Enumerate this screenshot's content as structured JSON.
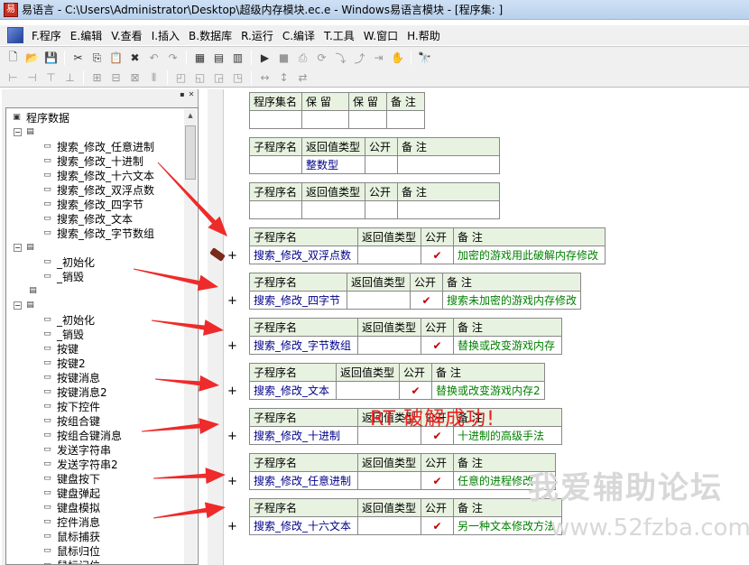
{
  "window": {
    "title": "易语言 - C:\\Users\\Administrator\\Desktop\\超级内存模块.ec.e - Windows易语言模块 - [程序集: ]"
  },
  "menu": [
    "F.程序",
    "E.编辑",
    "V.查看",
    "I.插入",
    "B.数据库",
    "R.运行",
    "C.编译",
    "T.工具",
    "W.窗口",
    "H.帮助"
  ],
  "tree": {
    "root": "程序数据",
    "group1_items": [
      "搜索_修改_任意进制",
      "搜索_修改_十进制",
      "搜索_修改_十六文本",
      "搜索_修改_双浮点数",
      "搜索_修改_四字节",
      "搜索_修改_文本",
      "搜索_修改_字节数组"
    ],
    "group2_items": [
      "_初始化",
      "_销毁"
    ],
    "group3_items": [
      "_初始化",
      "_销毁",
      "按键",
      "按键2",
      "按键消息",
      "按键消息2",
      "按下控件",
      "按组合键",
      "按组合键消息",
      "发送字符串",
      "发送字符串2",
      "键盘按下",
      "键盘弹起",
      "键盘模拟",
      "控件消息",
      "鼠标捕获",
      "鼠标归位",
      "鼠标记位"
    ]
  },
  "headers": {
    "assembly": [
      "程序集名",
      "保 留",
      "保 留",
      "备 注"
    ],
    "sub": [
      "子程序名",
      "返回值类型",
      "公开",
      "备 注"
    ]
  },
  "subs": [
    {
      "name": "",
      "ret": "整数型",
      "public": "",
      "note": ""
    },
    {
      "name": "",
      "ret": "",
      "public": "",
      "note": ""
    },
    {
      "name": "搜索_修改_双浮点数",
      "ret": "",
      "public": "✔",
      "note": "加密的游戏用此破解内存修改"
    },
    {
      "name": "搜索_修改_四字节",
      "ret": "",
      "public": "✔",
      "note": "搜索未加密的游戏内存修改"
    },
    {
      "name": "搜索_修改_字节数组",
      "ret": "",
      "public": "✔",
      "note": "替换或改变游戏内存"
    },
    {
      "name": "搜索_修改_文本",
      "ret": "",
      "public": "✔",
      "note": "替换或改变游戏内存2"
    },
    {
      "name": "搜索_修改_十进制",
      "ret": "",
      "public": "✔",
      "note": "十进制的高级手法"
    },
    {
      "name": "搜索_修改_任意进制",
      "ret": "",
      "public": "✔",
      "note": "任意的进程修改"
    },
    {
      "name": "搜索_修改_十六文本",
      "ret": "",
      "public": "✔",
      "note": "另一种文本修改方法"
    }
  ],
  "overlay": {
    "crack": "RT 破解成功!",
    "wm1": "我爱辅助论坛",
    "wm2": "www.52fzba.com"
  },
  "colors": {
    "arrow": "#ee2a2a",
    "header_bg": "#e8f2e0",
    "note": "#008000",
    "type": "#00008b"
  }
}
